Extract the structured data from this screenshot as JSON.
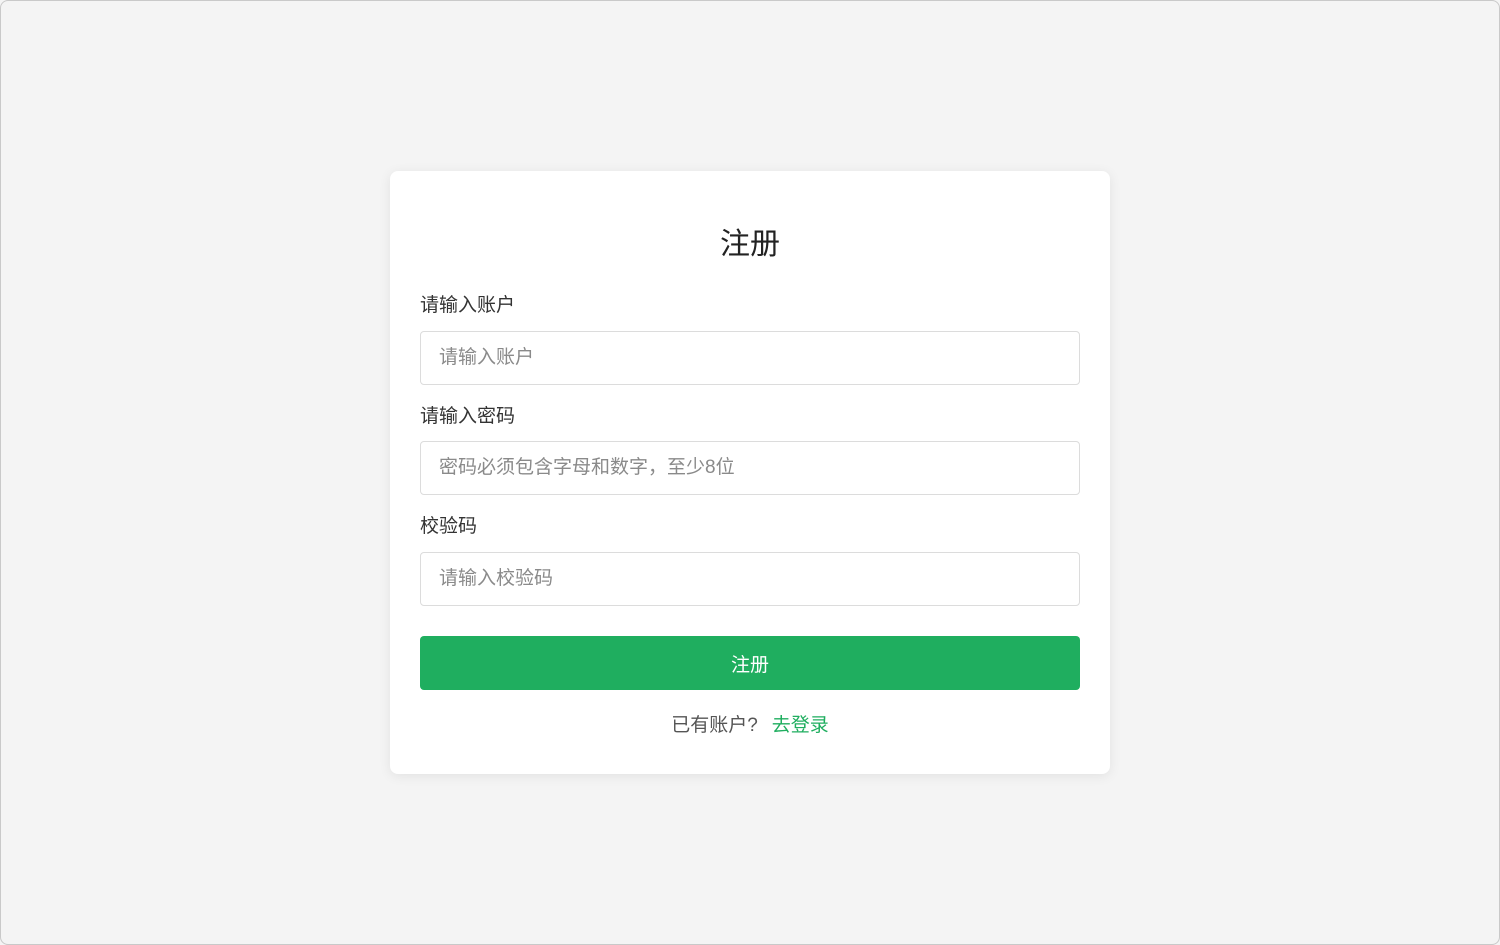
{
  "register": {
    "title": "注册",
    "account": {
      "label": "请输入账户",
      "placeholder": "请输入账户",
      "value": ""
    },
    "password": {
      "label": "请输入密码",
      "placeholder": "密码必须包含字母和数字，至少8位",
      "value": ""
    },
    "captcha": {
      "label": "校验码",
      "placeholder": "请输入校验码",
      "value": ""
    },
    "submit_label": "注册",
    "footer": {
      "prompt": "已有账户?",
      "login_link": "去登录"
    }
  },
  "colors": {
    "page_background": "#f4f4f4",
    "card_background": "#ffffff",
    "accent": "#1fae5f",
    "input_border": "#dcdcdc",
    "placeholder": "#8a8a8a"
  }
}
